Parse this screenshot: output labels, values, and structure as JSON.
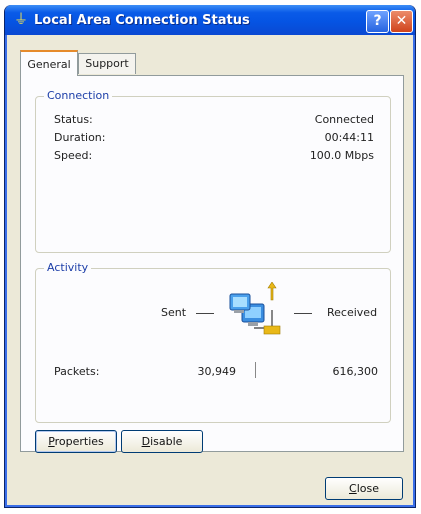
{
  "window": {
    "title": "Local Area Connection Status"
  },
  "title_buttons": {
    "help_label": "?",
    "close_label": "✕"
  },
  "tabs": [
    {
      "label": "General",
      "active": true
    },
    {
      "label": "Support",
      "active": false
    }
  ],
  "connection": {
    "legend": "Connection",
    "rows": [
      {
        "label": "Status:",
        "value": "Connected"
      },
      {
        "label": "Duration:",
        "value": "00:44:11"
      },
      {
        "label": "Speed:",
        "value": "100.0 Mbps"
      }
    ]
  },
  "activity": {
    "legend": "Activity",
    "sent_label": "Sent",
    "received_label": "Received",
    "packets_label": "Packets:",
    "packets_sent": "30,949",
    "packets_received": "616,300"
  },
  "buttons": {
    "properties": {
      "first": "P",
      "rest": "roperties"
    },
    "disable": {
      "first": "D",
      "rest": "isable"
    },
    "close": {
      "first": "C",
      "rest": "lose"
    }
  },
  "colors": {
    "titlebar": "#0554e3",
    "group_legend": "#1c3ea8",
    "window_bg": "#ece9d8"
  },
  "icons": {
    "title": "network-plug-icon",
    "activity": "network-computers-icon"
  }
}
